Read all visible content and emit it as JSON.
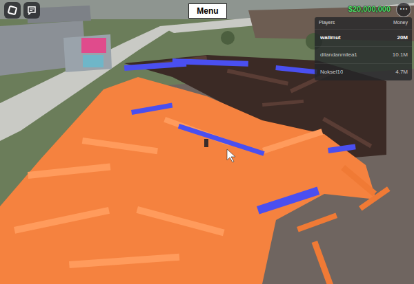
{
  "topbar": {
    "menu_button": "Menu",
    "money": "$20,000,000",
    "more_button": "⋯"
  },
  "leaderboard": {
    "columns": [
      "Players",
      "Money"
    ],
    "rows": [
      {
        "name": "wallmut",
        "money": "20M",
        "selected": true
      },
      {
        "name": "dilandanmilea1",
        "money": "10.1M",
        "selected": false
      },
      {
        "name": "Noksel10",
        "money": "4.7M",
        "selected": false
      }
    ]
  }
}
